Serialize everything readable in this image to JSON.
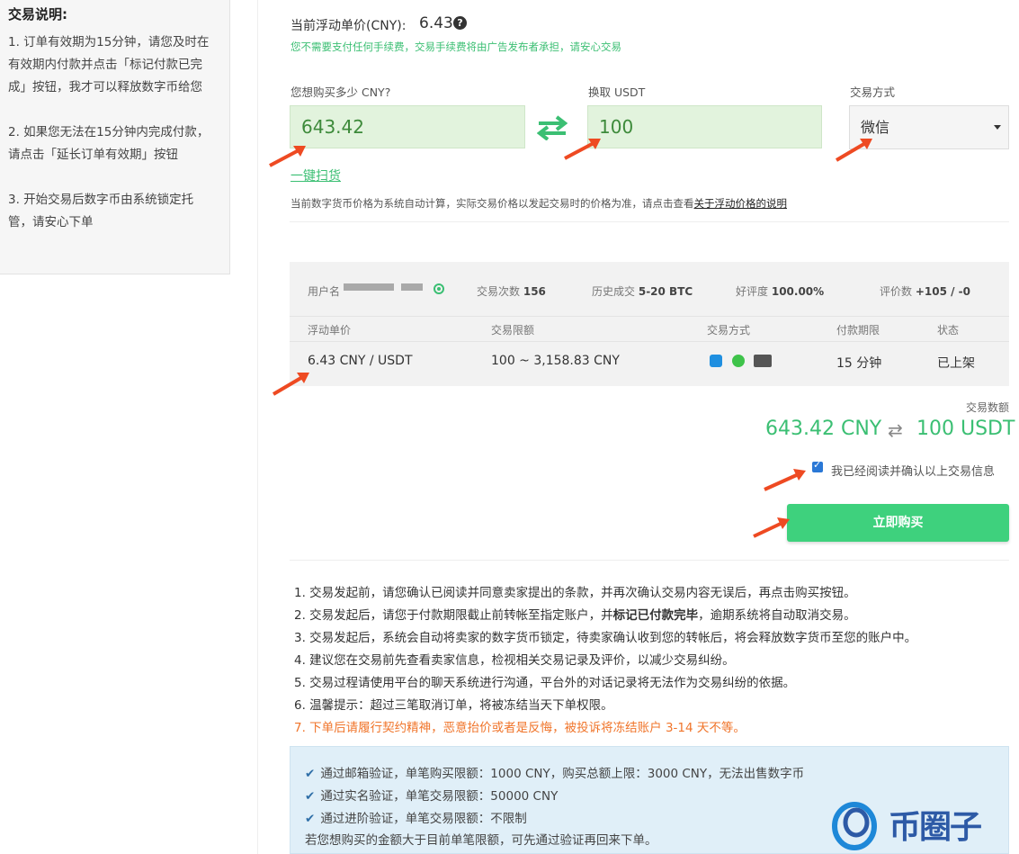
{
  "sidebar": {
    "title": "交易说明:",
    "notes": [
      "1. 订单有效期为15分钟，请您及时在有效期内付款并点击「标记付款已完成」按钮，我才可以释放数字币给您",
      "2. 如果您无法在15分钟内完成付款，请点击「延长订单有效期」按钮",
      "3. 开始交易后数字币由系统锁定托管，请安心下单"
    ]
  },
  "price": {
    "label": "当前浮动单价(CNY):",
    "value": "6.43",
    "help_icon": "question-circle-icon",
    "fee_note": "您不需要支付任何手续费，交易手续费将由广告发布者承担，请安心交易"
  },
  "form": {
    "cny_label": "您想购买多少 CNY?",
    "cny_value": "643.42",
    "usdt_label": "换取 USDT",
    "usdt_value": "100",
    "method_label": "交易方式",
    "method_value": "微信",
    "swap_icon": "swap-arrows-icon",
    "scan_link": "一键扫货",
    "calc_note": "当前数字货币价格为系统自动计算，实际交易价格以发起交易时的价格为准，请点击查看",
    "calc_link": "关于浮动价格的说明"
  },
  "seller": {
    "username_label": "用户名",
    "trades_label": "交易次数",
    "trades_value": "156",
    "history_label": "历史成交",
    "history_value": "5-20 BTC",
    "rating_label": "好评度",
    "rating_value": "100.00%",
    "reviews_label": "评价数",
    "reviews_value": "+105 / -0",
    "columns": [
      "浮动单价",
      "交易限额",
      "交易方式",
      "付款期限",
      "状态"
    ],
    "row": {
      "price": "6.43 CNY / USDT",
      "limit": "100 ~ 3,158.83 CNY",
      "methods": [
        "alipay-icon",
        "wechat-icon",
        "bank-card-icon"
      ],
      "period": "15 分钟",
      "status": "已上架"
    }
  },
  "summary": {
    "label": "交易数额",
    "cny": "643.42 CNY",
    "usdt": "100 USDT",
    "swap_symbol": "⇄",
    "confirm_text": "我已经阅读并确认以上交易信息",
    "confirm_checked": true,
    "buy_label": "立即购买"
  },
  "rules": [
    "1. 交易发起前，请您确认已阅读并同意卖家提出的条款，并再次确认交易内容无误后，再点击购买按钮。",
    "2. 交易发起后，请您于付款期限截止前转帐至指定账户，并",
    "3. 交易发起后，系统会自动将卖家的数字货币锁定，待卖家确认收到您的转帐后，将会释放数字货币至您的账户中。",
    "4. 建议您在交易前先查看卖家信息，检视相关交易记录及评价，以减少交易纠纷。",
    "5. 交易过程请使用平台的聊天系统进行沟通，平台外的对话记录将无法作为交易纠纷的依据。",
    "6. 温馨提示：超过三笔取消订单，将被冻结当天下单权限。",
    "7. 下单后请履行契约精神，恶意抬价或者是反悔，被投诉将冻结账户 3-14 天不等。"
  ],
  "rule2_bold": "标记已付款完毕",
  "rule2_tail": "，逾期系统将自动取消交易。",
  "verify": {
    "items": [
      "通过邮箱验证，单笔购买限额：1000 CNY，购买总额上限：3000 CNY，无法出售数字币",
      "通过实名验证，单笔交易限额：50000 CNY",
      "通过进阶验证，单笔交易限额：不限制"
    ],
    "footer": "若您想购买的金额大于目前单笔限额，可先通过验证再回来下单。"
  },
  "watermark": "币圈子",
  "colors": {
    "accent_green": "#3bbf73",
    "button_green": "#3ed17d",
    "input_bg": "#e2f3dd",
    "warning_orange": "#f0752b",
    "arrow_red": "#ee4a22",
    "verify_bg": "#e0eff8"
  }
}
